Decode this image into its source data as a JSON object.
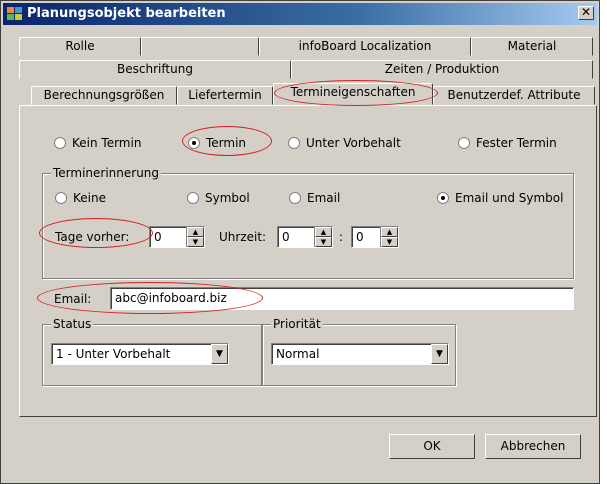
{
  "window": {
    "title": "Planungsobjekt bearbeiten",
    "close_glyph": "✕"
  },
  "tabs": {
    "row1": [
      "Rolle",
      "",
      "infoBoard Localization",
      "Material"
    ],
    "row2": [
      "Beschriftung",
      "Zeiten / Produktion"
    ],
    "row3": [
      "Berechnungsgrößen",
      "Liefertermin",
      "Termineigenschaften",
      "Benutzerdef. Attribute"
    ],
    "active": "Termineigenschaften"
  },
  "termin_type": {
    "options": [
      "Kein Termin",
      "Termin",
      "Unter Vorbehalt",
      "Fester Termin"
    ],
    "selected": "Termin"
  },
  "erinnerung": {
    "legend": "Terminerinnerung",
    "options": [
      "Keine",
      "Symbol",
      "Email",
      "Email und Symbol"
    ],
    "selected": "Email und Symbol",
    "tage_label": "Tage vorher:",
    "tage_value": "0",
    "uhrzeit_label": "Uhrzeit:",
    "hour_value": "0",
    "colon": ":",
    "minute_value": "0"
  },
  "email": {
    "label": "Email:",
    "value": "abc@infoboard.biz"
  },
  "status": {
    "legend": "Status",
    "value": "1 - Unter Vorbehalt"
  },
  "prioritaet": {
    "legend": "Priorität",
    "value": "Normal"
  },
  "buttons": {
    "ok": "OK",
    "cancel": "Abbrechen"
  },
  "annotation_color": "#d22222",
  "icons": {
    "spin_up": "▲",
    "spin_down": "▼",
    "dropdown": "▼"
  }
}
